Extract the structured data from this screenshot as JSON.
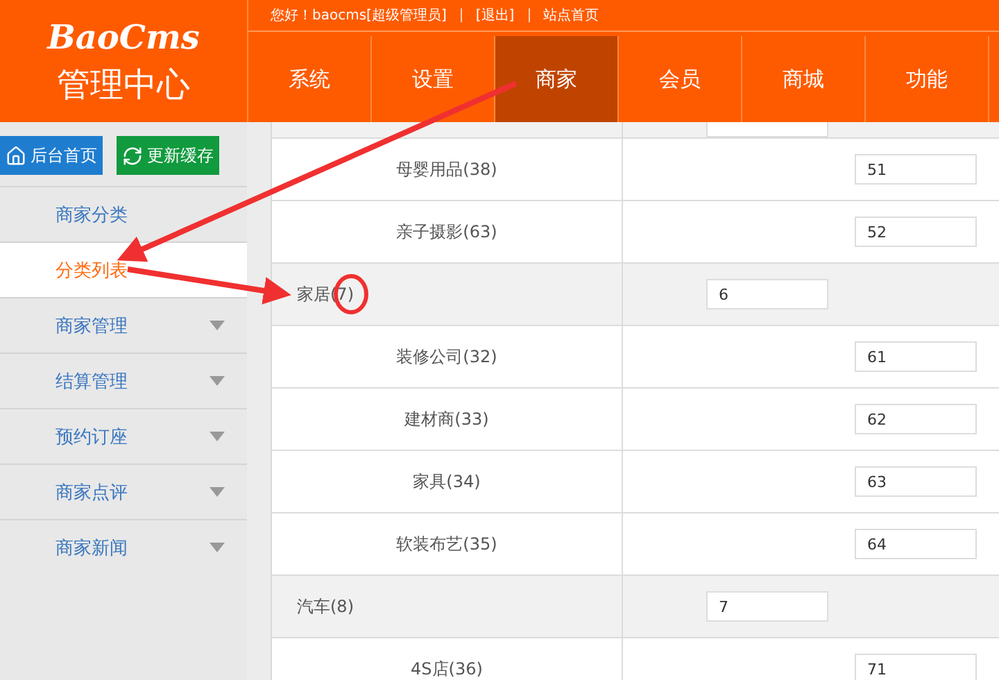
{
  "logo": {
    "brand": "BaoCms",
    "subtitle": "管理中心"
  },
  "top_bar": {
    "greeting": "您好！baocms[超级管理员]",
    "links": [
      "[退出]",
      "站点首页"
    ]
  },
  "nav": [
    {
      "label": "系统",
      "selected": false
    },
    {
      "label": "设置",
      "selected": false
    },
    {
      "label": "商家",
      "selected": true
    },
    {
      "label": "会员",
      "selected": false
    },
    {
      "label": "商城",
      "selected": false
    },
    {
      "label": "功能",
      "selected": false
    }
  ],
  "sidebar": {
    "buttons": [
      {
        "label": "后台首页",
        "kind": "home"
      },
      {
        "label": "更新缓存",
        "kind": "refresh"
      }
    ],
    "items": [
      {
        "label": "商家分类",
        "selected": false,
        "expandable": false
      },
      {
        "label": "分类列表",
        "selected": true,
        "expandable": false
      },
      {
        "label": "商家管理",
        "selected": false,
        "expandable": true
      },
      {
        "label": "结算管理",
        "selected": false,
        "expandable": true
      },
      {
        "label": "预约订座",
        "selected": false,
        "expandable": true
      },
      {
        "label": "商家点评",
        "selected": false,
        "expandable": true
      },
      {
        "label": "商家新闻",
        "selected": false,
        "expandable": true
      }
    ]
  },
  "table": {
    "rows": [
      {
        "kind": "child",
        "name": "母婴用品(38)",
        "order": "51"
      },
      {
        "kind": "child",
        "name": "亲子摄影(63)",
        "order": "52"
      },
      {
        "kind": "parent",
        "name": "家居(7)",
        "order": "6"
      },
      {
        "kind": "child",
        "name": "装修公司(32)",
        "order": "61"
      },
      {
        "kind": "child",
        "name": "建材商(33)",
        "order": "62"
      },
      {
        "kind": "child",
        "name": "家具(34)",
        "order": "63"
      },
      {
        "kind": "child",
        "name": "软装布艺(35)",
        "order": "64"
      },
      {
        "kind": "parent",
        "name": "汽车(8)",
        "order": "7"
      },
      {
        "kind": "child",
        "name": "4S店(36)",
        "order": "71"
      }
    ]
  }
}
